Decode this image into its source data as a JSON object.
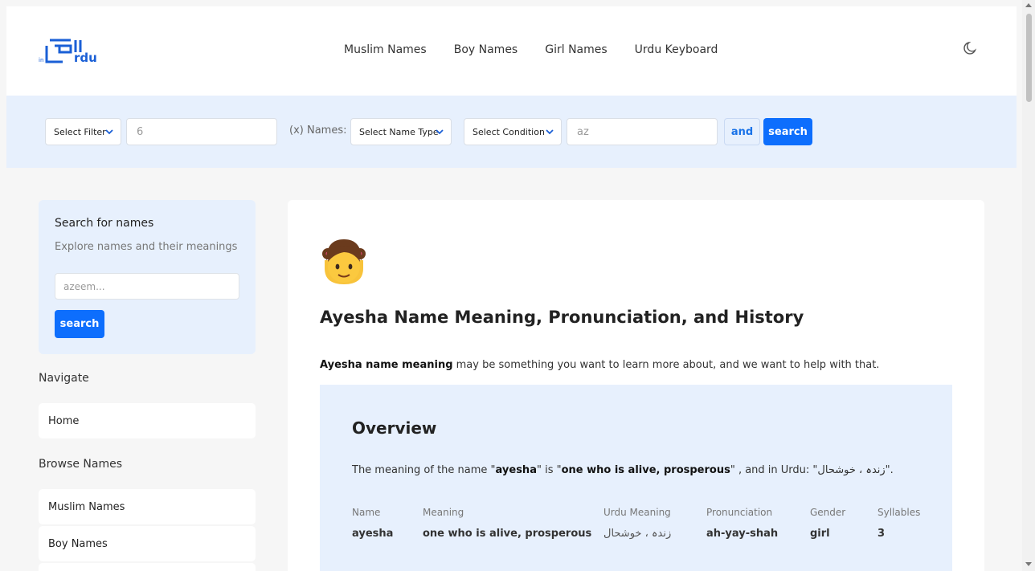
{
  "header": {
    "logo_icon": "naamurdu-logo",
    "nav": [
      "Muslim Names",
      "Boy Names",
      "Girl Names",
      "Urdu Keyboard"
    ],
    "theme_icon": "moon-icon"
  },
  "filter": {
    "filter_select": "Select Filter",
    "number_value": "6",
    "x_label": "(x) Names:",
    "name_type_select": "Select Name Type",
    "condition_select": "Select Condition",
    "text_value": "az",
    "and_label": "and",
    "search_label": "search"
  },
  "sidebar": {
    "search_title": "Search for names",
    "search_subtitle": "Explore names and their meanings",
    "search_placeholder": "azeem...",
    "search_button": "search",
    "navigate_heading": "Navigate",
    "navigate_items": [
      "Home"
    ],
    "browse_heading": "Browse Names",
    "browse_items": [
      "Muslim Names",
      "Boy Names"
    ]
  },
  "main": {
    "emoji_icon": "girl-emoji-icon",
    "title": "Ayesha Name Meaning, Pronunciation, and History",
    "intro_bold": "Ayesha name meaning",
    "intro_rest": " may be something you want to learn more about, and we want to help with that.",
    "overview": {
      "heading": "Overview",
      "line_pre": "The meaning of the name \"",
      "name": "ayesha",
      "line_mid": "\" is \"",
      "meaning": "one who is alive, prosperous",
      "line_post": "\" , and in Urdu: \"",
      "urdu": "زندہ ، خوشحال",
      "line_end": "\".",
      "columns": [
        {
          "header": "Name",
          "value": "ayesha"
        },
        {
          "header": "Meaning",
          "value": "one who is alive, prosperous"
        },
        {
          "header": "Urdu Meaning",
          "value": "زندہ ، خوشحال"
        },
        {
          "header": "Pronunciation",
          "value": "ah-yay-shah"
        },
        {
          "header": "Gender",
          "value": "girl"
        },
        {
          "header": "Syllables",
          "value": "3"
        }
      ]
    }
  },
  "colors": {
    "primary": "#0d6efd",
    "light_blue": "#e7f0fd"
  }
}
